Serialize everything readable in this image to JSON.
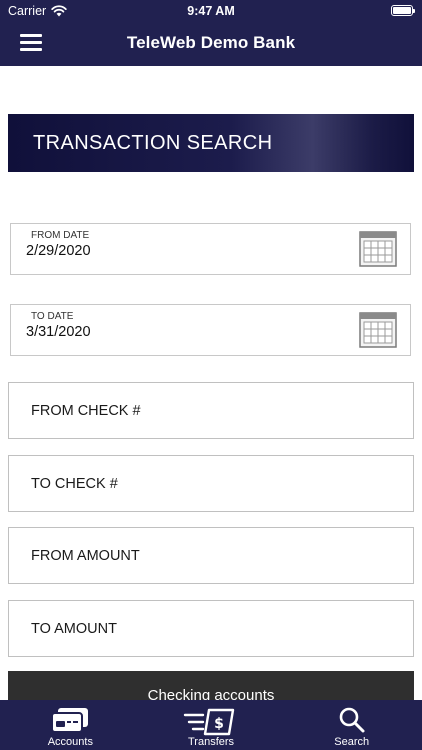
{
  "status_bar": {
    "carrier": "Carrier",
    "time": "9:47 AM"
  },
  "header": {
    "title": "TeleWeb Demo Bank",
    "menu_icon": "hamburger-icon"
  },
  "section": {
    "title": "TRANSACTION SEARCH"
  },
  "fields": {
    "from_date": {
      "label": "FROM DATE",
      "value": "2/29/2020",
      "icon": "calendar-icon"
    },
    "to_date": {
      "label": "TO DATE",
      "value": "3/31/2020",
      "icon": "calendar-icon"
    },
    "from_check": {
      "placeholder": "FROM CHECK #"
    },
    "to_check": {
      "placeholder": "TO CHECK #"
    },
    "from_amount": {
      "placeholder": "FROM AMOUNT"
    },
    "to_amount": {
      "placeholder": "TO AMOUNT"
    }
  },
  "account_selector": {
    "label": "Checking accounts"
  },
  "tab_bar": {
    "tabs": [
      {
        "label": "Accounts",
        "icon": "credit-card-icon"
      },
      {
        "label": "Transfers",
        "icon": "money-transfer-icon"
      },
      {
        "label": "Search",
        "icon": "search-icon"
      }
    ]
  },
  "colors": {
    "header_bg": "#212150",
    "banner_bg": "#10103a",
    "account_bar_bg": "#2f2f2f"
  }
}
